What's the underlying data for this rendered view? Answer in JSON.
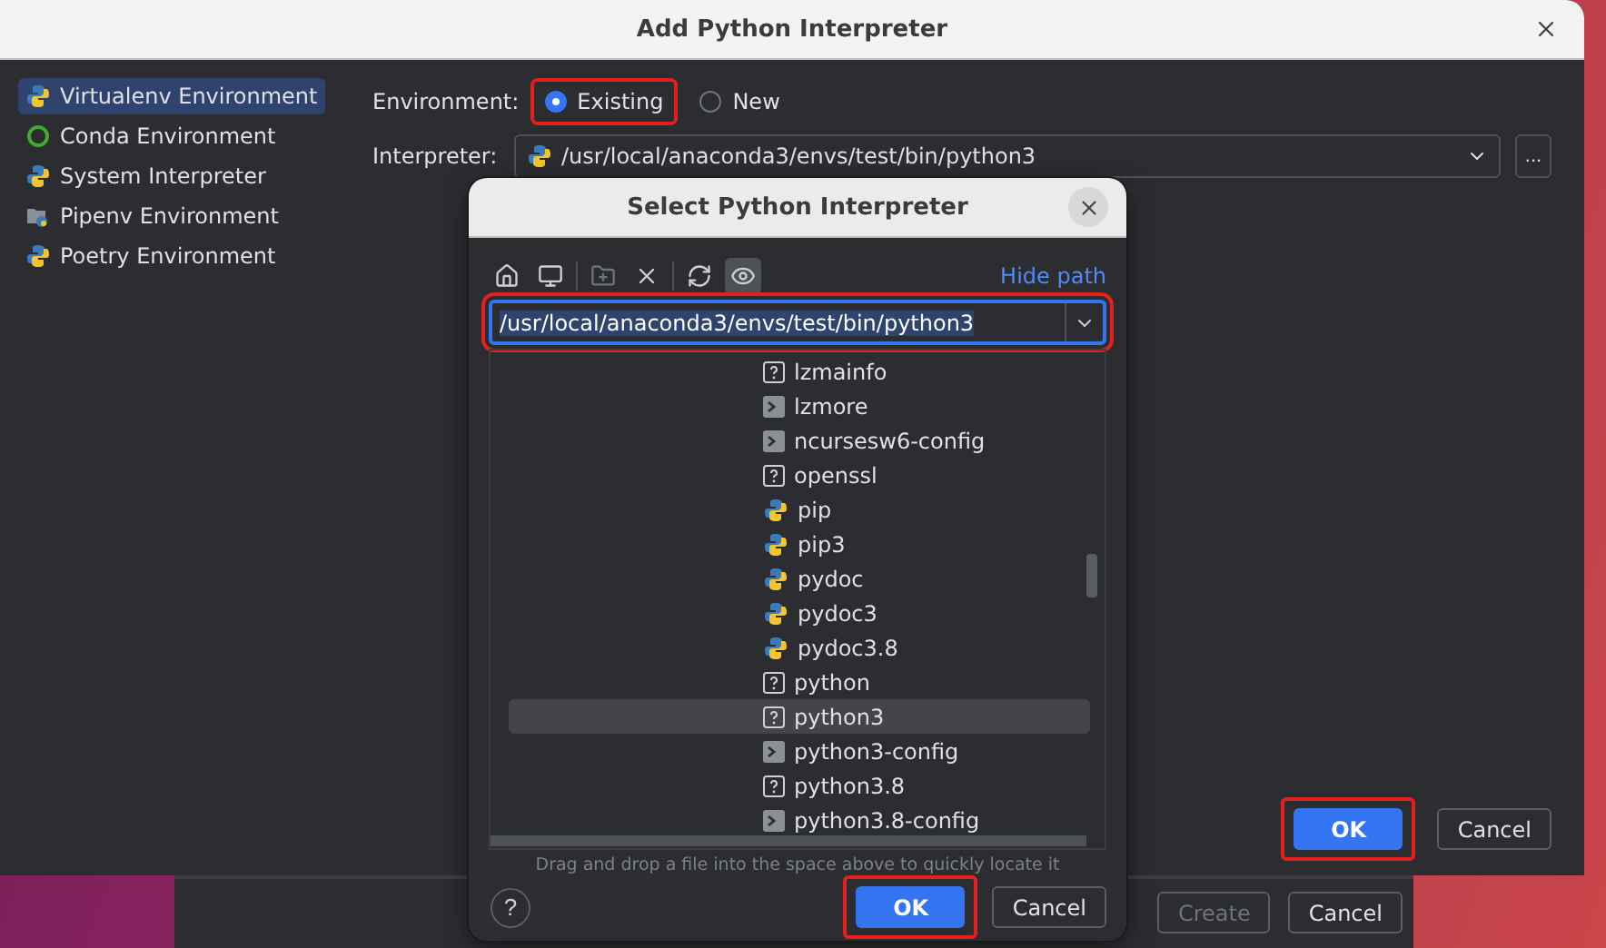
{
  "back_window": {
    "buttons": [
      {
        "label": "Create",
        "disabled": true
      },
      {
        "label": "Cancel",
        "disabled": false
      }
    ]
  },
  "dialog": {
    "title": "Add Python Interpreter",
    "sidebar": [
      {
        "label": "Virtualenv Environment",
        "kind": "virtualenv",
        "selected": true
      },
      {
        "label": "Conda Environment",
        "kind": "conda",
        "selected": false
      },
      {
        "label": "System Interpreter",
        "kind": "system",
        "selected": false
      },
      {
        "label": "Pipenv Environment",
        "kind": "pipenv",
        "selected": false
      },
      {
        "label": "Poetry Environment",
        "kind": "poetry",
        "selected": false
      }
    ],
    "environment": {
      "label": "Environment:",
      "options": [
        {
          "label": "Existing",
          "selected": true,
          "highlighted": true
        },
        {
          "label": "New",
          "selected": false,
          "highlighted": false
        }
      ]
    },
    "interpreter": {
      "label": "Interpreter:",
      "value": "/usr/local/anaconda3/envs/test/bin/python3",
      "more": "..."
    },
    "buttons": [
      {
        "label": "OK",
        "primary": true,
        "highlighted": true
      },
      {
        "label": "Cancel",
        "primary": false,
        "highlighted": false
      }
    ]
  },
  "file_chooser": {
    "title": "Select Python Interpreter",
    "toolbar": [
      {
        "kind": "home",
        "disabled": false,
        "selected": false
      },
      {
        "kind": "desktop",
        "disabled": false,
        "selected": false
      },
      {
        "kind": "new-folder",
        "disabled": true,
        "selected": false
      },
      {
        "kind": "delete",
        "disabled": false,
        "selected": false
      },
      {
        "kind": "refresh",
        "disabled": false,
        "selected": false
      },
      {
        "kind": "show-hidden",
        "disabled": false,
        "selected": true
      }
    ],
    "hide_path": "Hide path",
    "path": "/usr/local/anaconda3/envs/test/bin/python3",
    "path_highlighted": true,
    "files": [
      {
        "name": "lzmainfo",
        "kind": "unknown",
        "selected": false
      },
      {
        "name": "lzmore",
        "kind": "script",
        "selected": false
      },
      {
        "name": "ncursesw6-config",
        "kind": "script",
        "selected": false
      },
      {
        "name": "openssl",
        "kind": "unknown",
        "selected": false
      },
      {
        "name": "pip",
        "kind": "python",
        "selected": false
      },
      {
        "name": "pip3",
        "kind": "python",
        "selected": false
      },
      {
        "name": "pydoc",
        "kind": "python",
        "selected": false
      },
      {
        "name": "pydoc3",
        "kind": "python",
        "selected": false
      },
      {
        "name": "pydoc3.8",
        "kind": "python",
        "selected": false
      },
      {
        "name": "python",
        "kind": "unknown",
        "selected": false
      },
      {
        "name": "python3",
        "kind": "unknown",
        "selected": true
      },
      {
        "name": "python3-config",
        "kind": "script",
        "selected": false
      },
      {
        "name": "python3.8",
        "kind": "unknown",
        "selected": false
      },
      {
        "name": "python3.8-config",
        "kind": "script",
        "selected": false
      }
    ],
    "hint": "Drag and drop a file into the space above to quickly locate it",
    "help": "?",
    "buttons": [
      {
        "label": "OK",
        "primary": true,
        "highlighted": true
      },
      {
        "label": "Cancel",
        "primary": false,
        "highlighted": false
      }
    ]
  }
}
